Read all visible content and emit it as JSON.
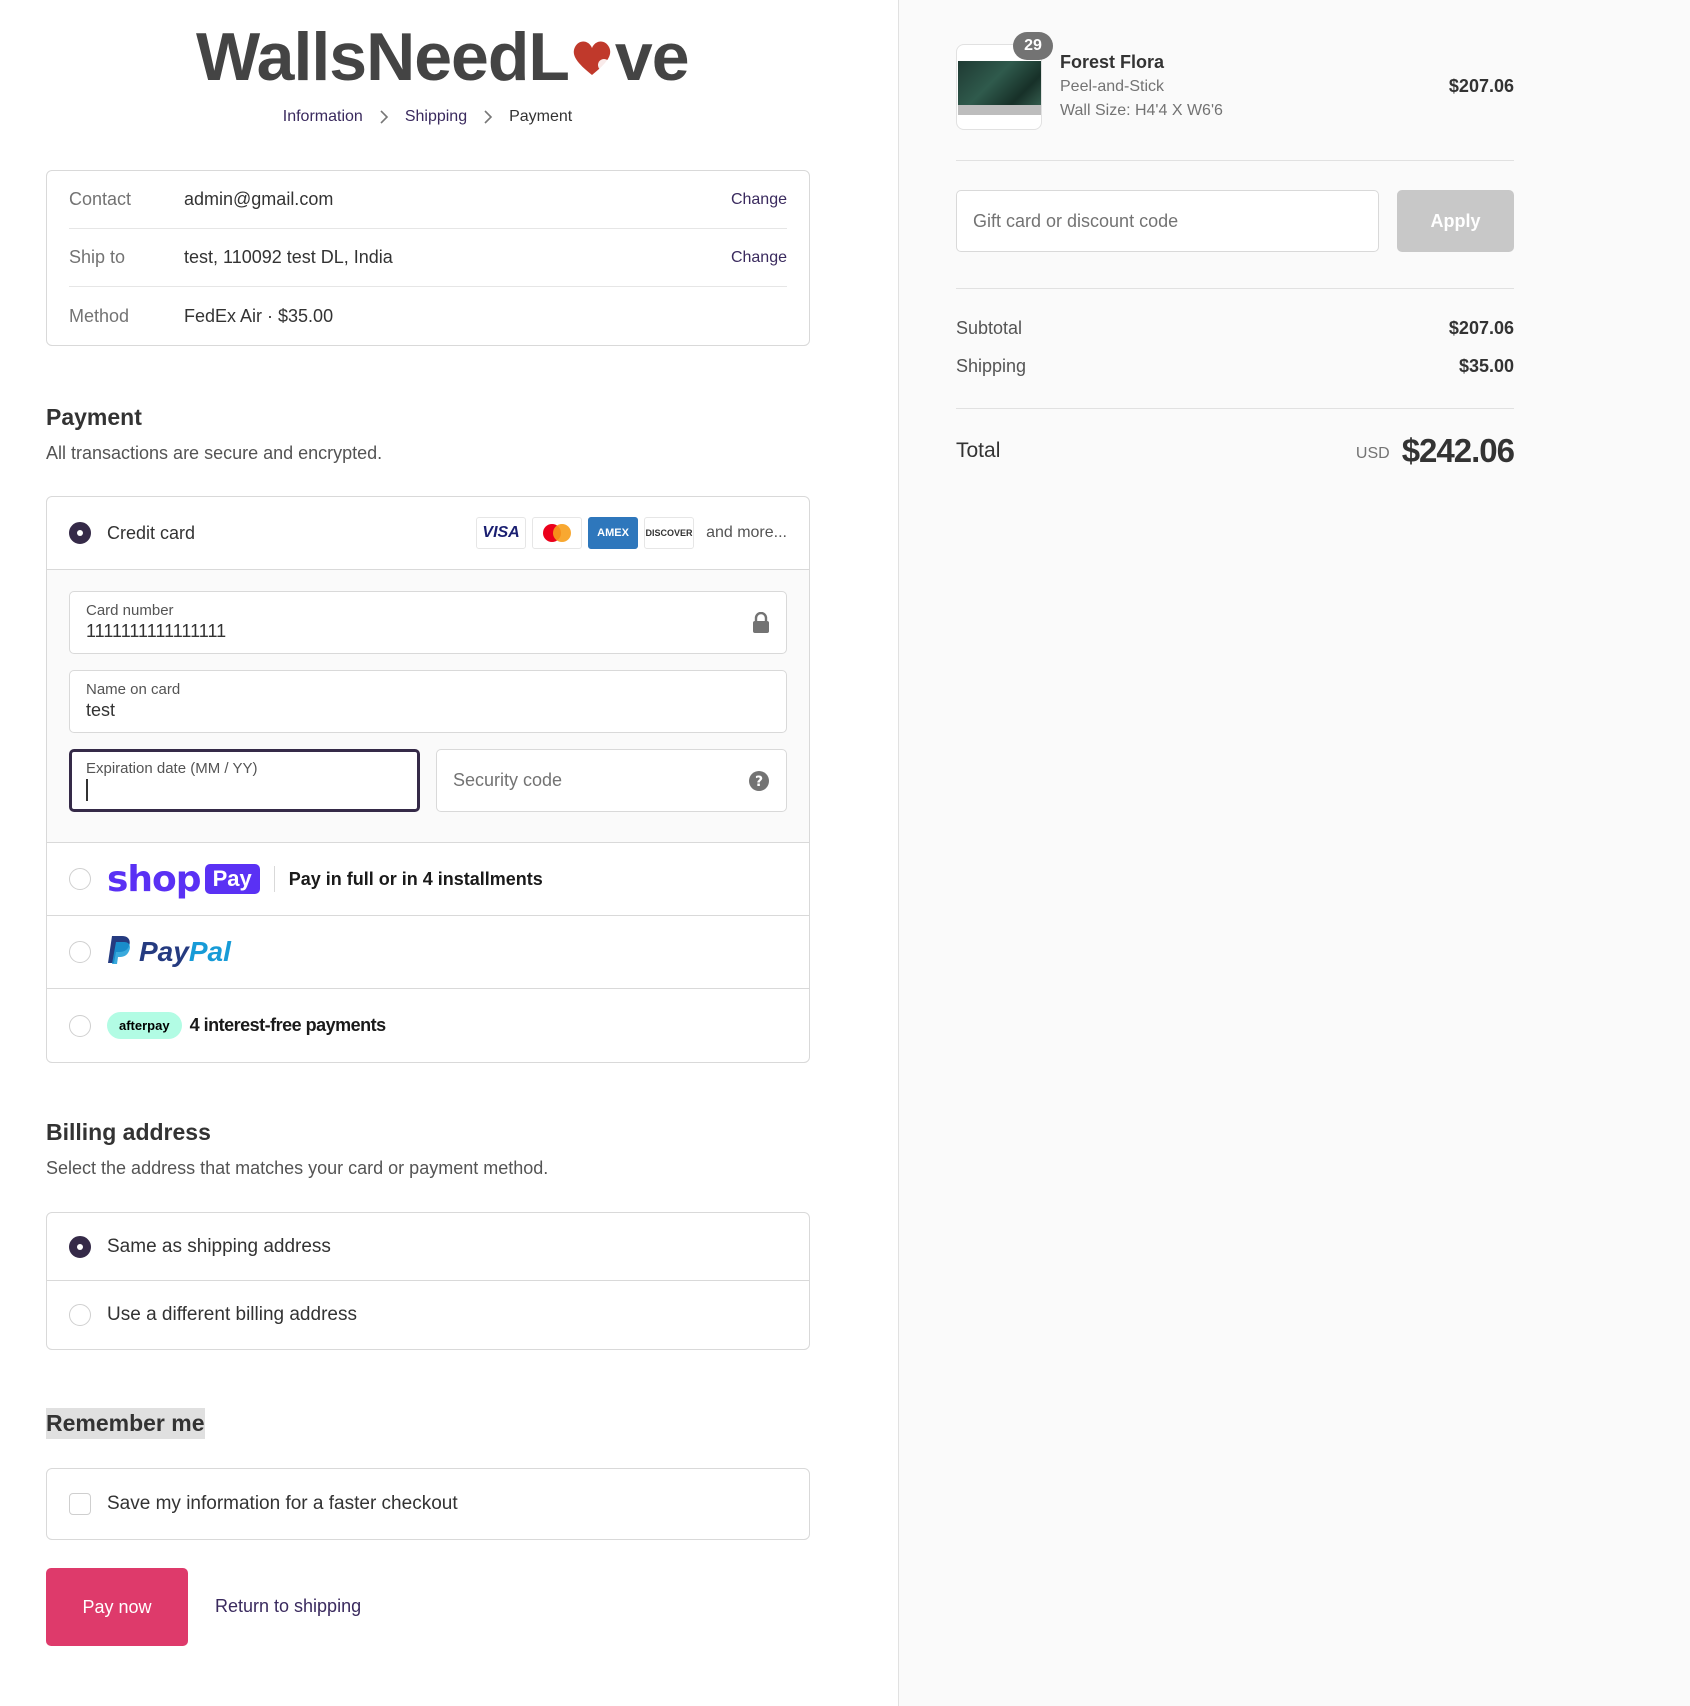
{
  "brand": {
    "name_part1": "WallsNeedL",
    "name_part2": "ve"
  },
  "breadcrumb": {
    "items": [
      "Information",
      "Shipping",
      "Payment"
    ]
  },
  "review": {
    "contact_label": "Contact",
    "contact_value": "admin@gmail.com",
    "shipto_label": "Ship to",
    "shipto_value": "test, 110092 test DL, India",
    "method_label": "Method",
    "method_value": "FedEx Air · $35.00",
    "change_label": "Change"
  },
  "payment": {
    "title": "Payment",
    "subtitle": "All transactions are secure and encrypted.",
    "credit_card_label": "Credit card",
    "card_brands": [
      "VISA",
      "AMEX",
      "DISCOVER"
    ],
    "and_more": "and more...",
    "card_number_label": "Card number",
    "card_number_value": "1111111111111111",
    "name_label": "Name on card",
    "name_value": "test",
    "expiry_label": "Expiration date (MM / YY)",
    "security_placeholder": "Security code",
    "shop": "shop",
    "shop_pay": "Pay",
    "shop_installments": "Pay in full or in 4 installments",
    "paypal_1": "Pay",
    "paypal_2": "Pal",
    "afterpay_badge": "afterpay",
    "afterpay_text": "4 interest-free payments"
  },
  "billing": {
    "title": "Billing address",
    "subtitle": "Select the address that matches your card or payment method.",
    "same_label": "Same as shipping address",
    "different_label": "Use a different billing address"
  },
  "remember": {
    "title": "Remember me",
    "save_label": "Save my information for a faster checkout"
  },
  "actions": {
    "pay_now": "Pay now",
    "return": "Return to shipping"
  },
  "summary": {
    "product": {
      "quantity": "29",
      "name": "Forest Flora",
      "type": "Peel-and-Stick",
      "size": "Wall Size: H4'4 X W6'6",
      "price": "$207.06"
    },
    "discount_placeholder": "Gift card or discount code",
    "apply_label": "Apply",
    "subtotal_label": "Subtotal",
    "subtotal_value": "$207.06",
    "shipping_label": "Shipping",
    "shipping_value": "$35.00",
    "total_label": "Total",
    "currency": "USD",
    "total_value": "$242.06"
  },
  "colors": {
    "accent": "#352a48",
    "pay_button": "#de3a6b",
    "shop_pay": "#5a31f4",
    "afterpay": "#b2fce4"
  }
}
